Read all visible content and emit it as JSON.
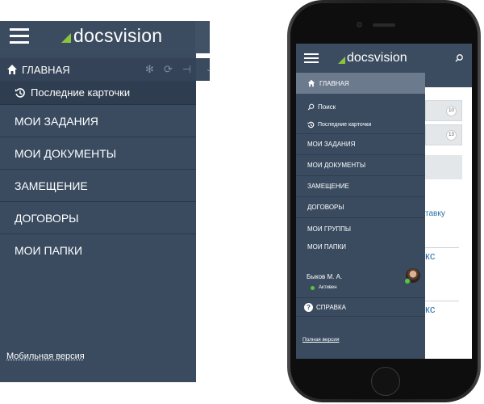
{
  "app": {
    "brand": "docsvision"
  },
  "desktop": {
    "home_label": "ГЛАВНАЯ",
    "recent_label": "Последние карточки",
    "menu_items": [
      "МОИ ЗАДАНИЯ",
      "МОИ ДОКУМЕНТЫ",
      "ЗАМЕЩЕНИЕ",
      "ДОГОВОРЫ",
      "МОИ ПАПКИ"
    ],
    "mobile_link": "Мобильная версия"
  },
  "mobile": {
    "home_label": "ГЛАВНАЯ",
    "search_label": "Поиск",
    "recent_label": "Последние карточки",
    "menu_items": [
      "МОИ ЗАДАНИЯ",
      "МОИ ДОКУМЕНТЫ",
      "ЗАМЕЩЕНИЕ",
      "ДОГОВОРЫ",
      "МОИ ГРУППЫ",
      "МОИ ПАПКИ"
    ],
    "user_name": "Быков М. А.",
    "user_status": "Активен",
    "help_label": "СПРАВКА",
    "full_link": "Полная версия",
    "content": {
      "badge_1": "10",
      "badge_2": "13",
      "link_text": "тавку",
      "fragment_1": "кс",
      "fragment_2": "кс"
    }
  },
  "colors": {
    "accent": "#8bc53f",
    "menu_bg": "#3a4b60",
    "header_bg": "#3c4c60",
    "online": "#5ac63c"
  }
}
